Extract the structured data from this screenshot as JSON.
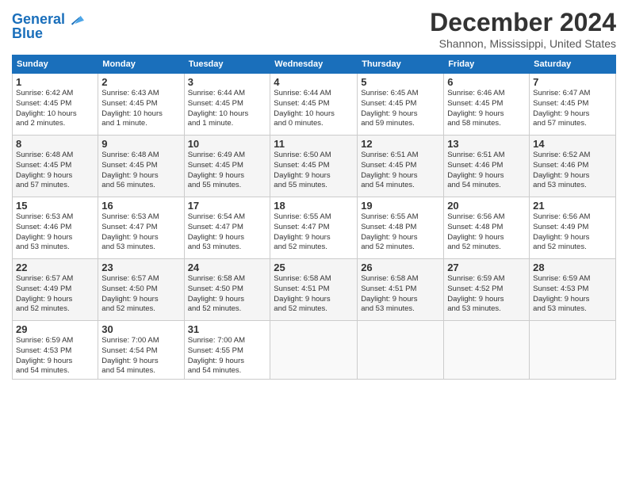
{
  "header": {
    "logo_line1": "General",
    "logo_line2": "Blue",
    "month_title": "December 2024",
    "location": "Shannon, Mississippi, United States"
  },
  "days_of_week": [
    "Sunday",
    "Monday",
    "Tuesday",
    "Wednesday",
    "Thursday",
    "Friday",
    "Saturday"
  ],
  "weeks": [
    [
      {
        "day": "1",
        "info": "Sunrise: 6:42 AM\nSunset: 4:45 PM\nDaylight: 10 hours\nand 2 minutes."
      },
      {
        "day": "2",
        "info": "Sunrise: 6:43 AM\nSunset: 4:45 PM\nDaylight: 10 hours\nand 1 minute."
      },
      {
        "day": "3",
        "info": "Sunrise: 6:44 AM\nSunset: 4:45 PM\nDaylight: 10 hours\nand 1 minute."
      },
      {
        "day": "4",
        "info": "Sunrise: 6:44 AM\nSunset: 4:45 PM\nDaylight: 10 hours\nand 0 minutes."
      },
      {
        "day": "5",
        "info": "Sunrise: 6:45 AM\nSunset: 4:45 PM\nDaylight: 9 hours\nand 59 minutes."
      },
      {
        "day": "6",
        "info": "Sunrise: 6:46 AM\nSunset: 4:45 PM\nDaylight: 9 hours\nand 58 minutes."
      },
      {
        "day": "7",
        "info": "Sunrise: 6:47 AM\nSunset: 4:45 PM\nDaylight: 9 hours\nand 57 minutes."
      }
    ],
    [
      {
        "day": "8",
        "info": "Sunrise: 6:48 AM\nSunset: 4:45 PM\nDaylight: 9 hours\nand 57 minutes."
      },
      {
        "day": "9",
        "info": "Sunrise: 6:48 AM\nSunset: 4:45 PM\nDaylight: 9 hours\nand 56 minutes."
      },
      {
        "day": "10",
        "info": "Sunrise: 6:49 AM\nSunset: 4:45 PM\nDaylight: 9 hours\nand 55 minutes."
      },
      {
        "day": "11",
        "info": "Sunrise: 6:50 AM\nSunset: 4:45 PM\nDaylight: 9 hours\nand 55 minutes."
      },
      {
        "day": "12",
        "info": "Sunrise: 6:51 AM\nSunset: 4:45 PM\nDaylight: 9 hours\nand 54 minutes."
      },
      {
        "day": "13",
        "info": "Sunrise: 6:51 AM\nSunset: 4:46 PM\nDaylight: 9 hours\nand 54 minutes."
      },
      {
        "day": "14",
        "info": "Sunrise: 6:52 AM\nSunset: 4:46 PM\nDaylight: 9 hours\nand 53 minutes."
      }
    ],
    [
      {
        "day": "15",
        "info": "Sunrise: 6:53 AM\nSunset: 4:46 PM\nDaylight: 9 hours\nand 53 minutes."
      },
      {
        "day": "16",
        "info": "Sunrise: 6:53 AM\nSunset: 4:47 PM\nDaylight: 9 hours\nand 53 minutes."
      },
      {
        "day": "17",
        "info": "Sunrise: 6:54 AM\nSunset: 4:47 PM\nDaylight: 9 hours\nand 53 minutes."
      },
      {
        "day": "18",
        "info": "Sunrise: 6:55 AM\nSunset: 4:47 PM\nDaylight: 9 hours\nand 52 minutes."
      },
      {
        "day": "19",
        "info": "Sunrise: 6:55 AM\nSunset: 4:48 PM\nDaylight: 9 hours\nand 52 minutes."
      },
      {
        "day": "20",
        "info": "Sunrise: 6:56 AM\nSunset: 4:48 PM\nDaylight: 9 hours\nand 52 minutes."
      },
      {
        "day": "21",
        "info": "Sunrise: 6:56 AM\nSunset: 4:49 PM\nDaylight: 9 hours\nand 52 minutes."
      }
    ],
    [
      {
        "day": "22",
        "info": "Sunrise: 6:57 AM\nSunset: 4:49 PM\nDaylight: 9 hours\nand 52 minutes."
      },
      {
        "day": "23",
        "info": "Sunrise: 6:57 AM\nSunset: 4:50 PM\nDaylight: 9 hours\nand 52 minutes."
      },
      {
        "day": "24",
        "info": "Sunrise: 6:58 AM\nSunset: 4:50 PM\nDaylight: 9 hours\nand 52 minutes."
      },
      {
        "day": "25",
        "info": "Sunrise: 6:58 AM\nSunset: 4:51 PM\nDaylight: 9 hours\nand 52 minutes."
      },
      {
        "day": "26",
        "info": "Sunrise: 6:58 AM\nSunset: 4:51 PM\nDaylight: 9 hours\nand 53 minutes."
      },
      {
        "day": "27",
        "info": "Sunrise: 6:59 AM\nSunset: 4:52 PM\nDaylight: 9 hours\nand 53 minutes."
      },
      {
        "day": "28",
        "info": "Sunrise: 6:59 AM\nSunset: 4:53 PM\nDaylight: 9 hours\nand 53 minutes."
      }
    ],
    [
      {
        "day": "29",
        "info": "Sunrise: 6:59 AM\nSunset: 4:53 PM\nDaylight: 9 hours\nand 54 minutes."
      },
      {
        "day": "30",
        "info": "Sunrise: 7:00 AM\nSunset: 4:54 PM\nDaylight: 9 hours\nand 54 minutes."
      },
      {
        "day": "31",
        "info": "Sunrise: 7:00 AM\nSunset: 4:55 PM\nDaylight: 9 hours\nand 54 minutes."
      },
      {
        "day": "",
        "info": ""
      },
      {
        "day": "",
        "info": ""
      },
      {
        "day": "",
        "info": ""
      },
      {
        "day": "",
        "info": ""
      }
    ]
  ]
}
